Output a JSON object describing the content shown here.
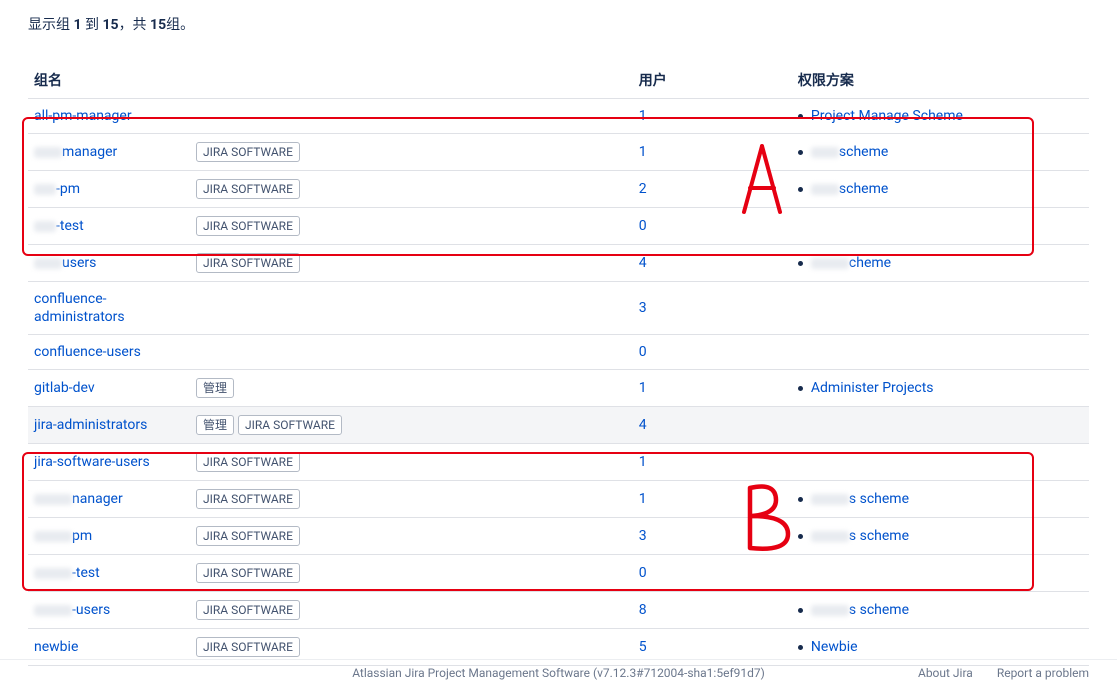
{
  "summary": {
    "prefix": "显示组 ",
    "start": "1",
    "mid1": " 到 ",
    "end": "15",
    "mid2": "，共 ",
    "total": "15",
    "suffix": "组。"
  },
  "headers": {
    "name": "组名",
    "users": "用户",
    "scheme": "权限方案"
  },
  "badges": {
    "jira": "JIRA SOFTWARE",
    "admin": "管理"
  },
  "rows": [
    {
      "name_pre_blur_w": 0,
      "name_text": "all-pm-manager",
      "badges": [],
      "users": "1",
      "scheme_pre_blur_w": 0,
      "scheme_text": "Project Manage Scheme"
    },
    {
      "name_pre_blur_w": 28,
      "name_text": "manager",
      "badges": [
        "jira"
      ],
      "users": "1",
      "scheme_pre_blur_w": 28,
      "scheme_text": "scheme"
    },
    {
      "name_pre_blur_w": 22,
      "name_text": "-pm",
      "badges": [
        "jira"
      ],
      "users": "2",
      "scheme_pre_blur_w": 28,
      "scheme_text": "scheme"
    },
    {
      "name_pre_blur_w": 22,
      "name_text": "-test",
      "badges": [
        "jira"
      ],
      "users": "0",
      "scheme_pre_blur_w": 0,
      "scheme_text": ""
    },
    {
      "name_pre_blur_w": 28,
      "name_text": "users",
      "badges": [
        "jira"
      ],
      "users": "4",
      "scheme_pre_blur_w": 38,
      "scheme_text": "cheme"
    },
    {
      "name_pre_blur_w": 0,
      "name_text": "confluence-administrators",
      "badges": [],
      "users": "3",
      "scheme_pre_blur_w": 0,
      "scheme_text": "",
      "wrap": true
    },
    {
      "name_pre_blur_w": 0,
      "name_text": "confluence-users",
      "badges": [],
      "users": "0",
      "scheme_pre_blur_w": 0,
      "scheme_text": ""
    },
    {
      "name_pre_blur_w": 0,
      "name_text": "gitlab-dev",
      "badges": [
        "admin"
      ],
      "users": "1",
      "scheme_pre_blur_w": 0,
      "scheme_text": "Administer Projects"
    },
    {
      "name_pre_blur_w": 0,
      "name_text": "jira-administrators",
      "badges": [
        "admin",
        "jira"
      ],
      "users": "4",
      "scheme_pre_blur_w": 0,
      "scheme_text": "",
      "highlighted": true
    },
    {
      "name_pre_blur_w": 0,
      "name_text": "jira-software-users",
      "badges": [
        "jira"
      ],
      "users": "1",
      "scheme_pre_blur_w": 0,
      "scheme_text": ""
    },
    {
      "name_pre_blur_w": 38,
      "name_text": "nanager",
      "badges": [
        "jira"
      ],
      "users": "1",
      "scheme_pre_blur_w": 38,
      "scheme_text": "s scheme"
    },
    {
      "name_pre_blur_w": 38,
      "name_text": "pm",
      "badges": [
        "jira"
      ],
      "users": "3",
      "scheme_pre_blur_w": 38,
      "scheme_text": "s scheme"
    },
    {
      "name_pre_blur_w": 38,
      "name_text": "-test",
      "badges": [
        "jira"
      ],
      "users": "0",
      "scheme_pre_blur_w": 0,
      "scheme_text": ""
    },
    {
      "name_pre_blur_w": 38,
      "name_text": "-users",
      "badges": [
        "jira"
      ],
      "users": "8",
      "scheme_pre_blur_w": 38,
      "scheme_text": "s scheme"
    },
    {
      "name_pre_blur_w": 0,
      "name_text": "newbie",
      "badges": [
        "jira"
      ],
      "users": "5",
      "scheme_pre_blur_w": 0,
      "scheme_text": "Newbie"
    }
  ],
  "footer": {
    "center": "Atlassian Jira Project Management Software (v7.12.3#712004-sha1:5ef91d7)",
    "about": "About Jira",
    "report": "Report a problem"
  }
}
